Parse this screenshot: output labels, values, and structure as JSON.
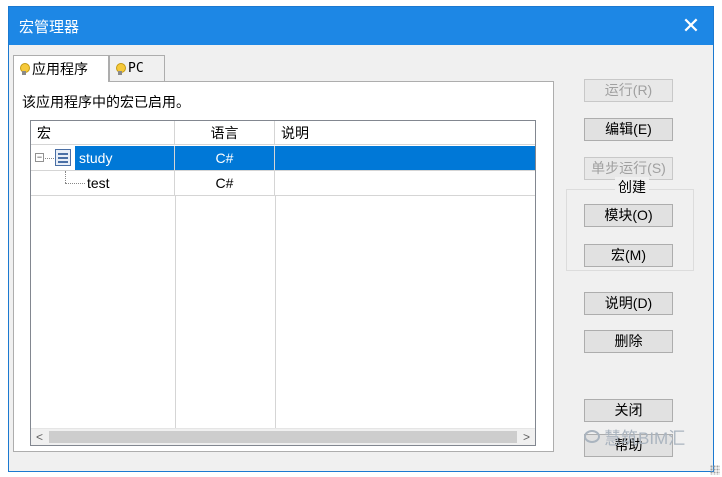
{
  "window": {
    "title": "宏管理器",
    "close_glyph": "✕"
  },
  "tabs": [
    {
      "label": "应用程序",
      "icon": "lightbulb-icon",
      "active": true
    },
    {
      "label": "PC",
      "icon": "lightbulb-icon",
      "active": false
    }
  ],
  "panel": {
    "status_text": "该应用程序中的宏已启用。"
  },
  "macro_list": {
    "columns": [
      "宏",
      "语言",
      "说明"
    ],
    "rows": [
      {
        "name": "study",
        "language": "C#",
        "description": "",
        "selected": true,
        "expand_glyph": "−"
      },
      {
        "name": "test",
        "language": "C#",
        "description": "",
        "selected": false
      }
    ],
    "scroll_left": "<",
    "scroll_right": ">"
  },
  "buttons": {
    "run": "运行(R)",
    "edit": "编辑(E)",
    "step": "单步运行(S)",
    "create_group": "创建",
    "module": "模块(O)",
    "macro": "宏(M)",
    "description": "说明(D)",
    "delete": "删除",
    "close": "关闭",
    "help": "帮助"
  },
  "watermark": {
    "text": "慧筑BIM汇"
  }
}
